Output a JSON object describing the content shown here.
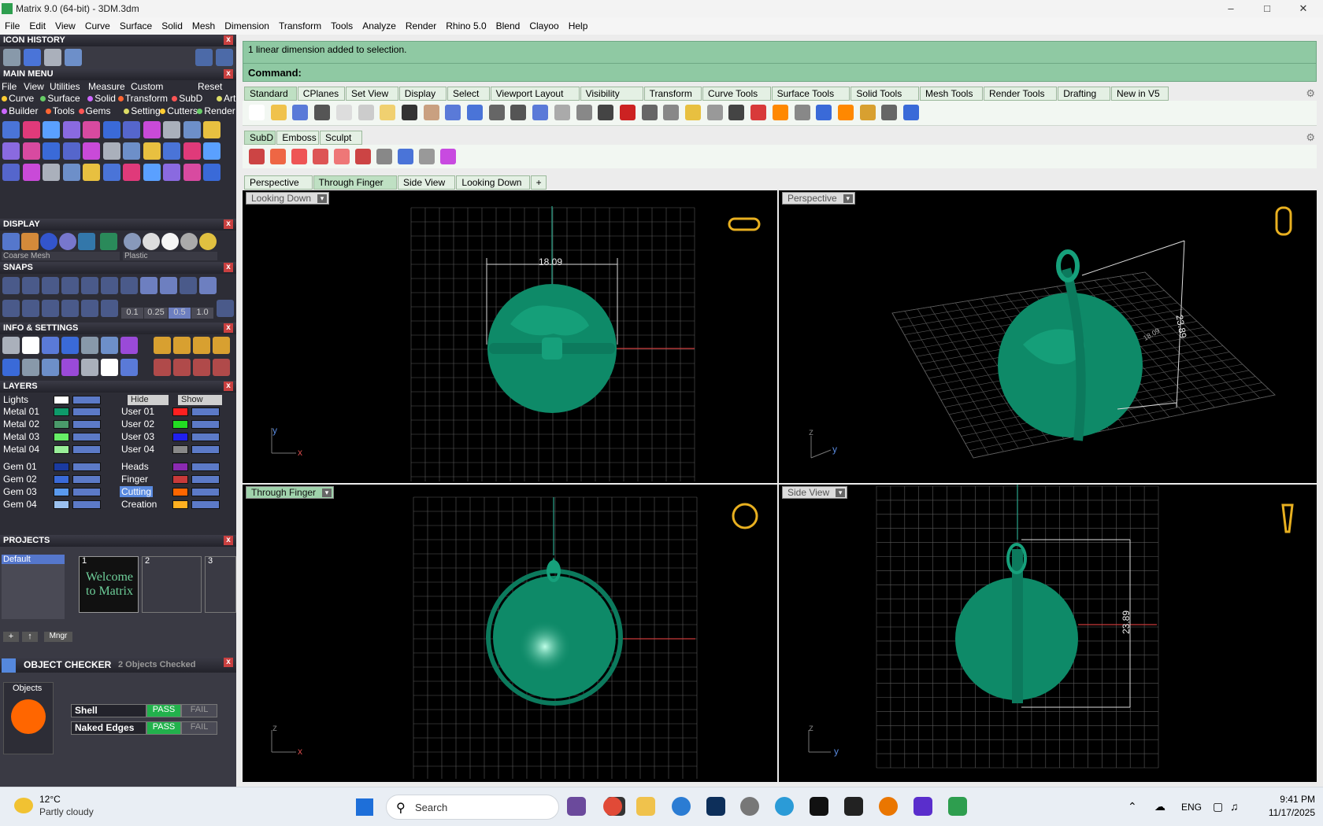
{
  "window": {
    "title": "Matrix 9.0 (64-bit) - 3DM.3dm"
  },
  "menubar": [
    "File",
    "Edit",
    "View",
    "Curve",
    "Surface",
    "Solid",
    "Mesh",
    "Dimension",
    "Transform",
    "Tools",
    "Analyze",
    "Render",
    "Rhino 5.0",
    "Blend",
    "Clayoo",
    "Help"
  ],
  "left": {
    "icon_history": "ICON HISTORY",
    "main_menu": "MAIN MENU",
    "main_menu_items": [
      "File",
      "View",
      "Utilities",
      "Measure",
      "Custom",
      "Reset"
    ],
    "cat_row1": [
      "Curve",
      "Surface",
      "Solid",
      "Transform",
      "SubD",
      "Art"
    ],
    "cat_row2": [
      "Builder",
      "Tools",
      "Gems",
      "Setting",
      "Cutters",
      "Render"
    ],
    "display": "DISPLAY",
    "display_mesh": "Coarse Mesh",
    "display_material": "Plastic",
    "snaps": "SNAPS",
    "snap_values": [
      "0.1",
      "0.25",
      "0.5",
      "1.0"
    ],
    "info_settings": "INFO & SETTINGS",
    "layers": "LAYERS",
    "lights_label": "Lights",
    "hide_label": "Hide",
    "show_label": "Show",
    "layers_left": [
      "Metal 01",
      "Metal 02",
      "Metal 03",
      "Metal 04",
      "Gem 01",
      "Gem 02",
      "Gem 03",
      "Gem 04"
    ],
    "layers_right": [
      "User 01",
      "User 02",
      "User 03",
      "User 04",
      "Heads",
      "Finger",
      "Cutting",
      "Creation"
    ],
    "projects": "PROJECTS",
    "project_default": "Default",
    "project_slots": [
      "1",
      "2",
      "3"
    ],
    "welcome": "Welcome to Matrix",
    "mngr": "Mngr",
    "object_checker": "OBJECT CHECKER",
    "objects_checked": "2 Objects Checked",
    "objects_label": "Objects",
    "checks": [
      {
        "name": "Shell",
        "pass": "PASS",
        "fail": "FAIL"
      },
      {
        "name": "Naked Edges",
        "pass": "PASS",
        "fail": "FAIL"
      }
    ]
  },
  "command": {
    "history": "1 linear dimension added to selection.",
    "prompt": "Command:"
  },
  "toolbar_tabs": [
    "Standard",
    "CPlanes",
    "Set View",
    "Display",
    "Select",
    "Viewport Layout",
    "Visibility",
    "Transform",
    "Curve Tools",
    "Surface Tools",
    "Solid Tools",
    "Mesh Tools",
    "Render Tools",
    "Drafting",
    "New in V5"
  ],
  "subd_tabs": [
    "SubD",
    "Emboss",
    "Sculpt"
  ],
  "viewport_tabs": [
    "Perspective",
    "Through Finger",
    "Side View",
    "Looking Down",
    "+"
  ],
  "viewports": {
    "tl": {
      "label": "Looking Down",
      "dimension": "18.09",
      "axes": [
        "y",
        "x"
      ]
    },
    "tr": {
      "label": "Perspective",
      "dimension": "23.89",
      "dimension2": "18.09",
      "axes": [
        "z",
        "y"
      ]
    },
    "bl": {
      "label": "Through Finger",
      "axes": [
        "z",
        "x"
      ]
    },
    "br": {
      "label": "Side View",
      "dimension": "23.89",
      "axes": [
        "z",
        "y"
      ]
    }
  },
  "taskbar": {
    "temp": "12°C",
    "weather": "Partly cloudy",
    "search": "Search",
    "lang": "ENG",
    "time": "9:41 PM",
    "date": "11/17/2025"
  },
  "colors": {
    "accent_green": "#8fc9a3",
    "panel_dark": "#2d2d36",
    "globe": "#0e8a68"
  }
}
